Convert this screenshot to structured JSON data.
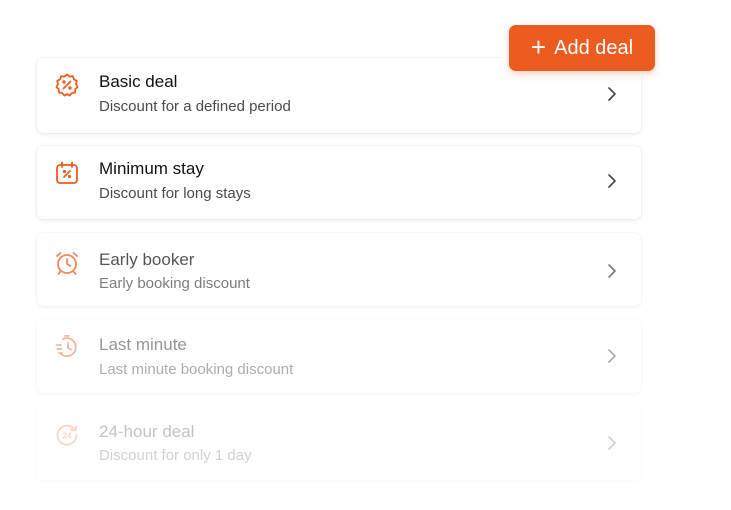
{
  "add_button": {
    "label": "Add deal",
    "icon": "plus-icon"
  },
  "accent_color": "#ec5b1f",
  "deals": [
    {
      "title": "Basic deal",
      "subtitle": "Discount for a defined period",
      "icon": "percent-badge-icon"
    },
    {
      "title": "Minimum stay",
      "subtitle": "Discount for long stays",
      "icon": "calendar-percent-icon"
    },
    {
      "title": "Early booker",
      "subtitle": "Early booking discount",
      "icon": "alarm-clock-icon"
    },
    {
      "title": "Last minute",
      "subtitle": "Last minute booking discount",
      "icon": "fast-timer-icon"
    },
    {
      "title": "24-hour deal",
      "subtitle": "Discount for only 1 day",
      "icon": "24-hour-icon"
    }
  ]
}
